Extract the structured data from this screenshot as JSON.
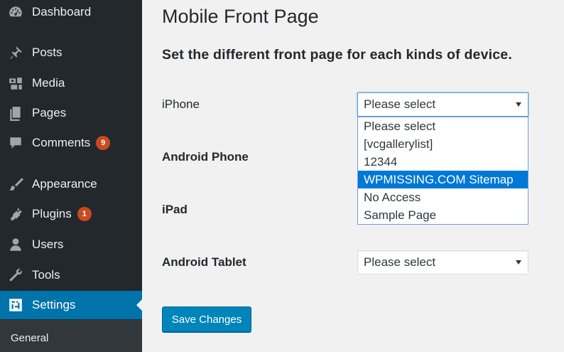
{
  "sidebar": {
    "items": [
      {
        "label": "Dashboard",
        "icon": "dashboard-icon"
      },
      {
        "label": "Posts",
        "icon": "pin-icon"
      },
      {
        "label": "Media",
        "icon": "media-icon"
      },
      {
        "label": "Pages",
        "icon": "pages-icon"
      },
      {
        "label": "Comments",
        "icon": "comment-icon",
        "badge": "9"
      },
      {
        "label": "Appearance",
        "icon": "brush-icon"
      },
      {
        "label": "Plugins",
        "icon": "plug-icon",
        "badge": "1"
      },
      {
        "label": "Users",
        "icon": "user-icon"
      },
      {
        "label": "Tools",
        "icon": "wrench-icon"
      },
      {
        "label": "Settings",
        "icon": "settings-icon",
        "active": true
      }
    ],
    "submenu": {
      "label": "General"
    }
  },
  "main": {
    "title": "Mobile Front Page",
    "subtitle": "Set the different front page for each kinds of device.",
    "rows": [
      {
        "label": "iPhone",
        "value": "Please select"
      },
      {
        "label": "Android Phone"
      },
      {
        "label": "iPad"
      },
      {
        "label": "Android Tablet",
        "value": "Please select"
      }
    ],
    "dropdown_options": [
      "Please select",
      "[vcgallerylist]",
      "12344",
      "WPMISSING.COM Sitemap",
      "No Access",
      "Sample Page"
    ],
    "highlighted_option": "WPMISSING.COM Sitemap",
    "save_label": "Save Changes"
  },
  "colors": {
    "sidebar_bg": "#23282d",
    "active_bg": "#0073aa",
    "badge_bg": "#ca4a1f",
    "button_bg": "#0085ba",
    "highlight_bg": "#0078d7"
  }
}
